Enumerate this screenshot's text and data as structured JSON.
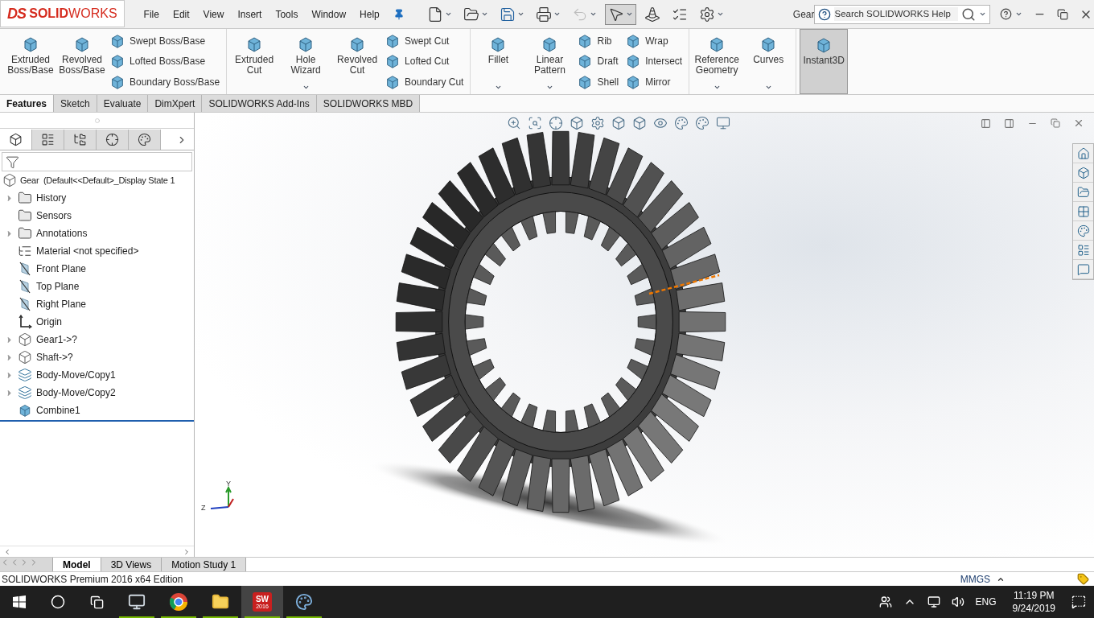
{
  "logo": {
    "mark": "DS",
    "name": "**SOLID**WORKS"
  },
  "menu": [
    "File",
    "Edit",
    "View",
    "Insert",
    "Tools",
    "Window",
    "Help"
  ],
  "quick_access": [
    {
      "kind": "new",
      "dropdown": true,
      "selected": false
    },
    {
      "kind": "open",
      "dropdown": true,
      "selected": false
    },
    {
      "kind": "save",
      "dropdown": true,
      "selected": false
    },
    {
      "kind": "print",
      "dropdown": true,
      "selected": false
    },
    {
      "kind": "undo",
      "dropdown": true,
      "selected": false,
      "disabled": true
    },
    {
      "kind": "select",
      "dropdown": true,
      "selected": true
    },
    {
      "kind": "rebuild",
      "dropdown": false,
      "selected": false
    },
    {
      "kind": "file-properties",
      "dropdown": false,
      "selected": false
    },
    {
      "kind": "options",
      "dropdown": true,
      "selected": false
    }
  ],
  "window": {
    "title": "Gear"
  },
  "search": {
    "placeholder": "Search SOLIDWORKS Help"
  },
  "ribbon": [
    {
      "tools": [
        {
          "kind": "large",
          "label": "Extruded Boss/Base",
          "dropdown": false,
          "selected": false
        },
        {
          "kind": "large",
          "label": "Revolved Boss/Base",
          "dropdown": false,
          "selected": false
        },
        {
          "kind": "stack",
          "items": [
            "Swept Boss/Base",
            "Lofted Boss/Base",
            "Boundary Boss/Base"
          ]
        }
      ]
    },
    {
      "tools": [
        {
          "kind": "large",
          "label": "Extruded Cut",
          "dropdown": false,
          "selected": false
        },
        {
          "kind": "large",
          "label": "Hole Wizard",
          "dropdown": true,
          "selected": false
        },
        {
          "kind": "large",
          "label": "Revolved Cut",
          "dropdown": false,
          "selected": false
        },
        {
          "kind": "stack",
          "items": [
            "Swept Cut",
            "Lofted Cut",
            "Boundary Cut"
          ]
        }
      ]
    },
    {
      "tools": [
        {
          "kind": "large",
          "label": "Fillet",
          "dropdown": true,
          "selected": false
        },
        {
          "kind": "large",
          "label": "Linear Pattern",
          "dropdown": true,
          "selected": false
        },
        {
          "kind": "stack",
          "items": [
            "Rib",
            "Draft",
            "Shell"
          ]
        },
        {
          "kind": "stack",
          "items": [
            "Wrap",
            "Intersect",
            "Mirror"
          ]
        }
      ]
    },
    {
      "tools": [
        {
          "kind": "large",
          "label": "Reference Geometry",
          "dropdown": true,
          "selected": false
        },
        {
          "kind": "large",
          "label": "Curves",
          "dropdown": true,
          "selected": false
        }
      ]
    },
    {
      "tools": [
        {
          "kind": "large",
          "label": "Instant3D",
          "dropdown": false,
          "selected": true
        }
      ]
    }
  ],
  "command_tabs": [
    {
      "label": "Features",
      "selected": true
    },
    {
      "label": "Sketch",
      "selected": false
    },
    {
      "label": "Evaluate",
      "selected": false
    },
    {
      "label": "DimXpert",
      "selected": false
    },
    {
      "label": "SOLIDWORKS Add-Ins",
      "selected": false
    },
    {
      "label": "SOLIDWORKS MBD",
      "selected": false
    }
  ],
  "manager_tabs": [
    {
      "kind": "feature-tree",
      "selected": true
    },
    {
      "kind": "property",
      "selected": false
    },
    {
      "kind": "configuration",
      "selected": false
    },
    {
      "kind": "dimxpert",
      "selected": false
    },
    {
      "kind": "display",
      "selected": false
    }
  ],
  "tree": {
    "root": "Gear  (Default<<Default>_Display State 1",
    "items": [
      {
        "kind": "history",
        "label": "History",
        "expanded": false
      },
      {
        "kind": "sensors",
        "label": "Sensors"
      },
      {
        "kind": "annotations",
        "label": "Annotations",
        "expanded": false
      },
      {
        "kind": "material",
        "label": "Material <not specified>"
      },
      {
        "kind": "plane",
        "label": "Front Plane"
      },
      {
        "kind": "plane",
        "label": "Top Plane"
      },
      {
        "kind": "plane",
        "label": "Right Plane"
      },
      {
        "kind": "origin",
        "label": "Origin"
      },
      {
        "kind": "part",
        "label": "Gear1->?",
        "expanded": false
      },
      {
        "kind": "part",
        "label": "Shaft->?",
        "expanded": false
      },
      {
        "kind": "move",
        "label": "Body-Move/Copy1",
        "expanded": false
      },
      {
        "kind": "move",
        "label": "Body-Move/Copy2",
        "expanded": false
      },
      {
        "kind": "combine",
        "label": "Combine1"
      }
    ]
  },
  "triad": {
    "y": "Y",
    "z": "Z"
  },
  "bottom_tabs": [
    {
      "label": "Model",
      "selected": true
    },
    {
      "label": "3D Views",
      "selected": false
    },
    {
      "label": "Motion Study 1",
      "selected": false
    }
  ],
  "status_bar": {
    "text": "SOLIDWORKS Premium 2016 x64 Edition",
    "units": "MMGS"
  },
  "taskbar": {
    "apps": [
      {
        "kind": "monitor",
        "running": true,
        "selected": false
      },
      {
        "kind": "chrome",
        "running": true,
        "selected": false
      },
      {
        "kind": "explorer",
        "running": true,
        "selected": false
      },
      {
        "kind": "solidworks",
        "running": true,
        "selected": true,
        "text": "SW",
        "subtext": "2016"
      },
      {
        "kind": "paint",
        "running": true,
        "selected": false
      }
    ],
    "language": "ENG",
    "time": "11:19 PM",
    "date": "9/24/2019"
  }
}
